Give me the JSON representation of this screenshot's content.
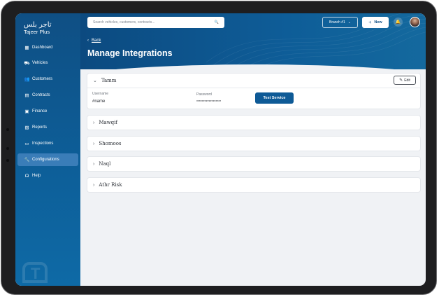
{
  "app": {
    "logo_arabic": "تاجر بلس",
    "logo_english": "Tajeer Plus"
  },
  "sidebar": {
    "items": [
      {
        "label": "Dashboard",
        "icon": "dashboard-icon",
        "glyph": "▦"
      },
      {
        "label": "Vehicles",
        "icon": "car-icon",
        "glyph": "⛟"
      },
      {
        "label": "Customers",
        "icon": "users-icon",
        "glyph": "👥"
      },
      {
        "label": "Contracts",
        "icon": "document-icon",
        "glyph": "▤"
      },
      {
        "label": "Finance",
        "icon": "finance-icon",
        "glyph": "▣"
      },
      {
        "label": "Reports",
        "icon": "reports-icon",
        "glyph": "▧"
      },
      {
        "label": "Inspections",
        "icon": "inspection-icon",
        "glyph": "▭"
      },
      {
        "label": "Configurations",
        "icon": "wrench-icon",
        "glyph": "🔧",
        "active": true
      },
      {
        "label": "Help",
        "icon": "headset-icon",
        "glyph": "☊"
      }
    ]
  },
  "header": {
    "search_placeholder": "Search vehicles, customers, contracts...",
    "search_icon": "🔍",
    "branch_label": "Branch #1",
    "branch_chevron": "⌄",
    "new_plus": "+",
    "new_label": "New",
    "bell_glyph": "🔔"
  },
  "page": {
    "back_chevron": "‹",
    "back_label": "Back",
    "title": "Manage Integrations"
  },
  "tamm": {
    "name": "Tamm",
    "chevron": "⌄",
    "edit_glyph": "✎",
    "edit_label": "Edit",
    "username_label": "Username",
    "username_value": "#name",
    "password_label": "Password",
    "password_value": "******************",
    "test_label": "Test Service"
  },
  "integrations": [
    {
      "name": "Mawqif",
      "chevron": "›"
    },
    {
      "name": "Shomoos",
      "chevron": "›"
    },
    {
      "name": "Naql",
      "chevron": "›"
    },
    {
      "name": "Athr Risk",
      "chevron": "›"
    }
  ],
  "colors": {
    "brand": "#0e5a96",
    "sidebar_active": "#3a7db8"
  }
}
